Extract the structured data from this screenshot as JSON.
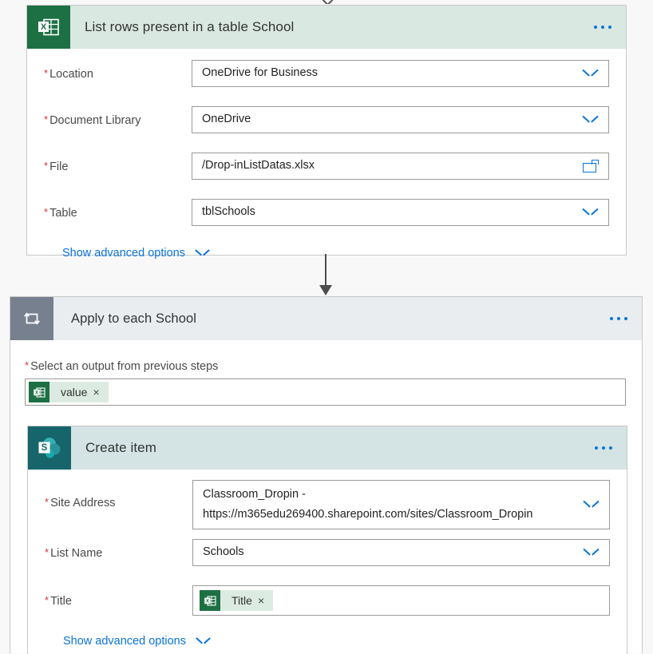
{
  "excel_action": {
    "title": "List rows present in a table School",
    "icon": "excel-icon",
    "menu": "more-options",
    "fields": [
      {
        "label": "Location",
        "value": "OneDrive for Business",
        "control": "dropdown"
      },
      {
        "label": "Document Library",
        "value": "OneDrive",
        "control": "dropdown"
      },
      {
        "label": "File",
        "value": "/Drop-inListDatas.xlsx",
        "control": "filepicker"
      },
      {
        "label": "Table",
        "value": "tblSchools",
        "control": "dropdown"
      }
    ],
    "advanced_label": "Show advanced options"
  },
  "loop_action": {
    "title": "Apply to each School",
    "icon": "loop-icon",
    "select_output_label": "Select an output from previous steps",
    "output_token": {
      "text": "value",
      "remove": "×",
      "icon": "excel-icon"
    }
  },
  "sharepoint_action": {
    "title": "Create item",
    "icon": "sharepoint-icon",
    "fields": [
      {
        "label": "Site Address",
        "value": "Classroom_Dropin - https://m365edu269400.sharepoint.com/sites/Classroom_Dropin",
        "line1": "Classroom_Dropin -",
        "line2": "https://m365edu269400.sharepoint.com/sites/Classroom_Dropin",
        "control": "dropdown"
      },
      {
        "label": "List Name",
        "value": "Schools",
        "control": "dropdown"
      },
      {
        "label": "Title",
        "value": "Title",
        "control": "token"
      }
    ],
    "title_token": {
      "text": "Title",
      "remove": "×",
      "icon": "excel-icon"
    },
    "advanced_label": "Show advanced options"
  },
  "colors": {
    "excel_green": "#1d7044",
    "excel_header": "#d9e8e0",
    "sharepoint_teal": "#15656b",
    "sharepoint_header": "#d4e4e4",
    "loop_gray": "#76808f",
    "loop_header": "#e9edf0",
    "link_blue": "#0a74d8",
    "required_red": "#d13438"
  }
}
